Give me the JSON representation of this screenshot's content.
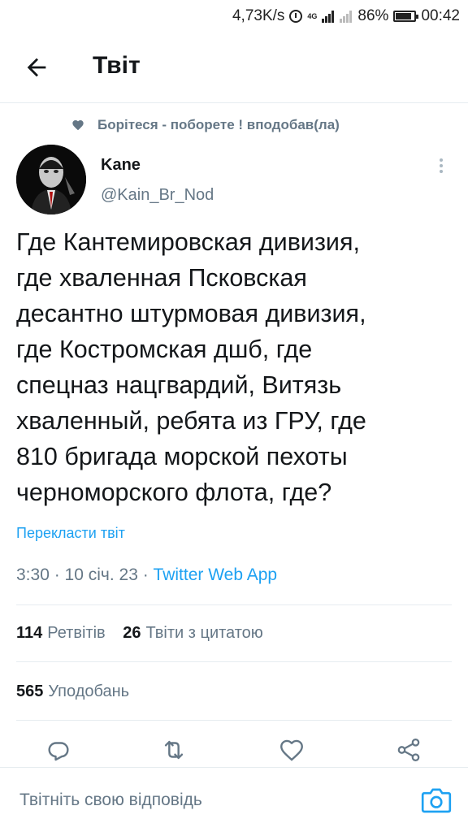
{
  "status_bar": {
    "net_speed": "4,73K/s",
    "network_type": "4G",
    "battery": "86%",
    "battery_level": 0.86,
    "time": "00:42"
  },
  "header": {
    "back_icon": "arrow-left-icon",
    "title": "Твіт"
  },
  "social_context": {
    "icon": "heart-icon",
    "text": "Борітеся - поборете ! вподобав(ла)"
  },
  "author": {
    "name": "Kane",
    "handle": "@Kain_Br_Nod"
  },
  "tweet": {
    "text": "Где Кантемировская дивизия,\nгде хваленная Псковская\nдесантно штурмовая дивизия,\nгде Костромская дшб, где\nспецназ нацгвардий, Витязь\nхваленный, ребята из ГРУ, где\n810 бригада морской пехоты\nчерноморского флота, где?",
    "translate_label": "Перекласти твіт",
    "time": "3:30",
    "date": "10 січ. 23",
    "separator": " · ",
    "source": "Twitter Web App"
  },
  "stats": {
    "retweets_count": "114",
    "retweets_label": "Ретвітів",
    "quotes_count": "26",
    "quotes_label": "Твіти з цитатою",
    "likes_count": "565",
    "likes_label": "Уподобань"
  },
  "actions": [
    "reply-icon",
    "retweet-icon",
    "like-icon",
    "share-icon"
  ],
  "reply": {
    "placeholder": "Твітніть свою відповідь",
    "camera_icon": "camera-icon"
  },
  "colors": {
    "accent": "#1da1f2",
    "secondary_text": "#657786",
    "primary_text": "#14171a",
    "divider": "#e6ecf0"
  }
}
